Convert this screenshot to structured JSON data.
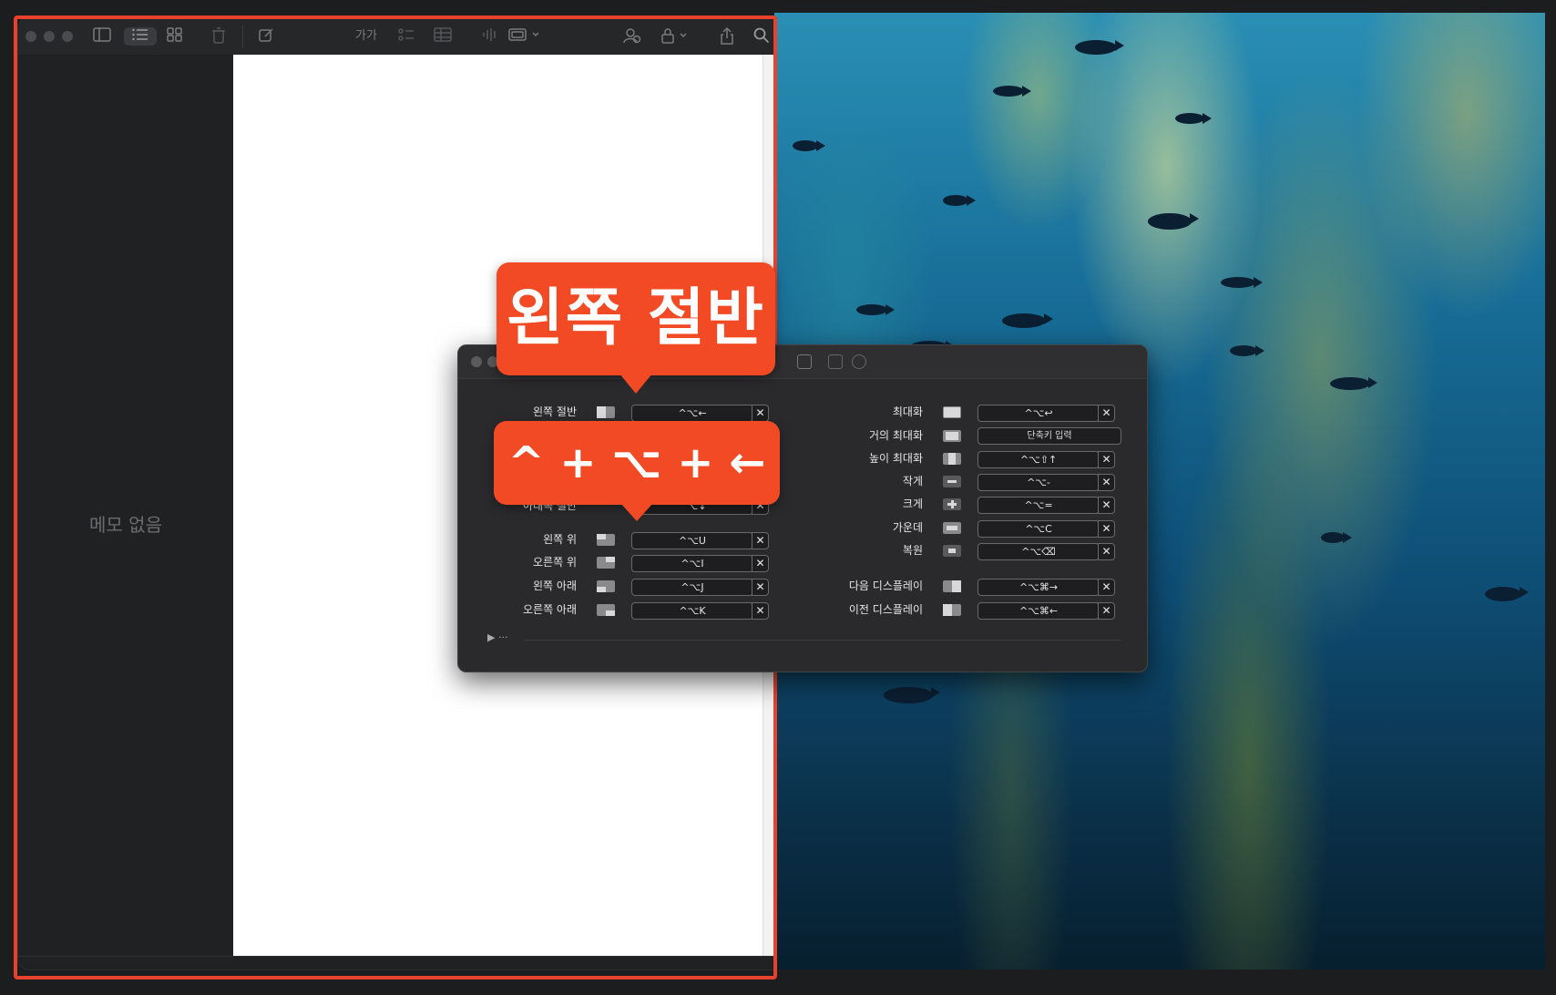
{
  "notes": {
    "empty_label": "메모 없음",
    "toolbar": {
      "sidebar_icon": "sidebar-icon",
      "list_view_icon": "list-view-icon",
      "gallery_icon": "gallery-icon",
      "trash_icon": "trash-icon",
      "compose_icon": "compose-icon",
      "format_text": "가가",
      "checklist_icon": "checklist-icon",
      "table_icon": "table-icon",
      "audio_icon": "audio-icon",
      "media_icon": "media-icon",
      "collab_icon": "collaboration-icon",
      "lock_icon": "lock-icon",
      "share_icon": "share-icon",
      "search_icon": "search-icon"
    }
  },
  "callouts": {
    "title": "왼쪽 절반",
    "keys": "^ + ⌥ + ←"
  },
  "shortcuts": {
    "left_column": [
      {
        "label": "왼쪽 절반",
        "icon": "left-half-icon",
        "shortcut": "^⌥←"
      },
      {
        "label": "",
        "icon": "right-half-icon",
        "shortcut": "^⌥→"
      },
      {
        "label": "",
        "icon": "top-half-icon",
        "shortcut": "^⌥↑"
      },
      {
        "label": "아래쪽 절반",
        "icon": "bottom-half-icon",
        "shortcut": "^⌥↓"
      },
      {
        "label": "왼쪽 위",
        "icon": "top-left-icon",
        "shortcut": "^⌥U"
      },
      {
        "label": "오른쪽 위",
        "icon": "top-right-icon",
        "shortcut": "^⌥I"
      },
      {
        "label": "왼쪽 아래",
        "icon": "bottom-left-icon",
        "shortcut": "^⌥J"
      },
      {
        "label": "오른쪽 아래",
        "icon": "bottom-right-icon",
        "shortcut": "^⌥K"
      }
    ],
    "right_column": [
      {
        "label": "최대화",
        "icon": "maximize-icon",
        "shortcut": "^⌥↩"
      },
      {
        "label": "거의 최대화",
        "icon": "almost-maximize-icon",
        "shortcut": "단축키 입력"
      },
      {
        "label": "높이 최대화",
        "icon": "maximize-height-icon",
        "shortcut": "^⌥⇧↑"
      },
      {
        "label": "작게",
        "icon": "smaller-icon",
        "shortcut": "^⌥-"
      },
      {
        "label": "크게",
        "icon": "larger-icon",
        "shortcut": "^⌥="
      },
      {
        "label": "가운데",
        "icon": "center-icon",
        "shortcut": "^⌥C"
      },
      {
        "label": "복원",
        "icon": "restore-icon",
        "shortcut": "^⌥⌫"
      },
      {
        "label": "다음 디스플레이",
        "icon": "next-display-icon",
        "shortcut": "^⌥⌘→"
      },
      {
        "label": "이전 디스플레이",
        "icon": "previous-display-icon",
        "shortcut": "^⌥⌘←"
      }
    ],
    "clear_glyph": "✕",
    "advanced_toggle": "▶ ···"
  },
  "colors": {
    "accent": "#f24a24",
    "outline": "#e8412c",
    "window_bg": "#1f2123",
    "panel_bg": "#2a2a2c"
  }
}
